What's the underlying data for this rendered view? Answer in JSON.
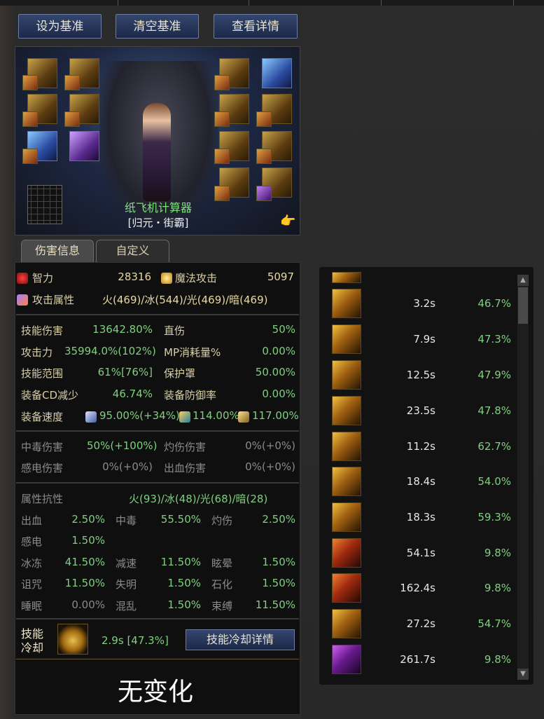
{
  "buttons": {
    "set_baseline": "设为基准",
    "clear_baseline": "清空基准",
    "view_details": "查看详情",
    "cooldown_details": "技能冷却详情"
  },
  "character": {
    "name": "纸飞机计算器",
    "title": "[归元・街霸]"
  },
  "tabs": {
    "damage_info": "伤害信息",
    "custom": "自定义"
  },
  "stats": {
    "intelligence_label": "智力",
    "intelligence": "28316",
    "magic_attack_label": "魔法攻击",
    "magic_attack": "5097",
    "attack_attr_label": "攻击属性",
    "attack_attr": "火(469)/冰(544)/光(469)/暗(469)",
    "skill_damage_label": "技能伤害",
    "skill_damage": "13642.80%",
    "direct_damage_label": "直伤",
    "direct_damage": "50%",
    "attack_power_label": "攻击力",
    "attack_power": "35994.0%(102%)",
    "mp_cost_label": "MP消耗量%",
    "mp_cost": "0.00%",
    "skill_range_label": "技能范围",
    "skill_range": "61%[76%]",
    "shield_label": "保护罩",
    "shield": "50.00%",
    "equip_cd_label": "装备CD减少",
    "equip_cd": "46.74%",
    "equip_defense_label": "装备防御率",
    "equip_defense": "0.00%",
    "equip_speed_label": "装备速度",
    "speed_1": "95.00%(+34%)",
    "speed_2": "114.00%",
    "speed_3": "117.00%"
  },
  "dot": {
    "poison_label": "中毒伤害",
    "poison": "50%(+100%)",
    "burn_label": "灼伤伤害",
    "burn": "0%(+0%)",
    "shock_label": "感电伤害",
    "shock": "0%(+0%)",
    "bleed_label": "出血伤害",
    "bleed": "0%(+0%)"
  },
  "resist": {
    "label": "属性抗性",
    "values": "火(93)/冰(48)/光(68)/暗(28)",
    "bleed_l": "出血",
    "bleed": "2.50%",
    "poison_l": "中毒",
    "poison": "55.50%",
    "burn_l": "灼伤",
    "burn": "2.50%",
    "shock_l": "感电",
    "shock": "1.50%",
    "freeze_l": "冰冻",
    "freeze": "41.50%",
    "slow_l": "减速",
    "slow": "11.50%",
    "stun_l": "眩晕",
    "stun": "1.50%",
    "curse_l": "诅咒",
    "curse": "11.50%",
    "blind_l": "失明",
    "blind": "1.50%",
    "stone_l": "石化",
    "stone": "1.50%",
    "sleep_l": "睡眠",
    "sleep": "0.00%",
    "confuse_l": "混乱",
    "confuse": "1.50%",
    "bind_l": "束缚",
    "bind": "11.50%"
  },
  "cooldown": {
    "label_line1": "技能",
    "label_line2": "冷却",
    "value": "2.9s [47.3%]"
  },
  "no_change": "无变化",
  "skills": [
    {
      "icon": "slash-skill-icon",
      "time": "3.2s",
      "pct": "46.7%"
    },
    {
      "icon": "pillar-skill-icon",
      "time": "7.9s",
      "pct": "47.3%"
    },
    {
      "icon": "crown-ring-skill-icon",
      "time": "12.5s",
      "pct": "47.9%"
    },
    {
      "icon": "whirlwind-skill-icon",
      "time": "23.5s",
      "pct": "47.8%"
    },
    {
      "icon": "spiral-skill-icon",
      "time": "11.2s",
      "pct": "62.7%"
    },
    {
      "icon": "sunburst-skill-icon",
      "time": "18.4s",
      "pct": "54.0%"
    },
    {
      "icon": "vortex-skill-icon",
      "time": "18.3s",
      "pct": "59.3%"
    },
    {
      "icon": "beast-skill-icon",
      "time": "54.1s",
      "pct": "9.8%"
    },
    {
      "icon": "flame-skill-icon",
      "time": "162.4s",
      "pct": "9.8%"
    },
    {
      "icon": "burst-skill-icon",
      "time": "27.2s",
      "pct": "54.7%"
    },
    {
      "icon": "purple-orb-skill-icon",
      "time": "261.7s",
      "pct": "9.8%"
    }
  ]
}
